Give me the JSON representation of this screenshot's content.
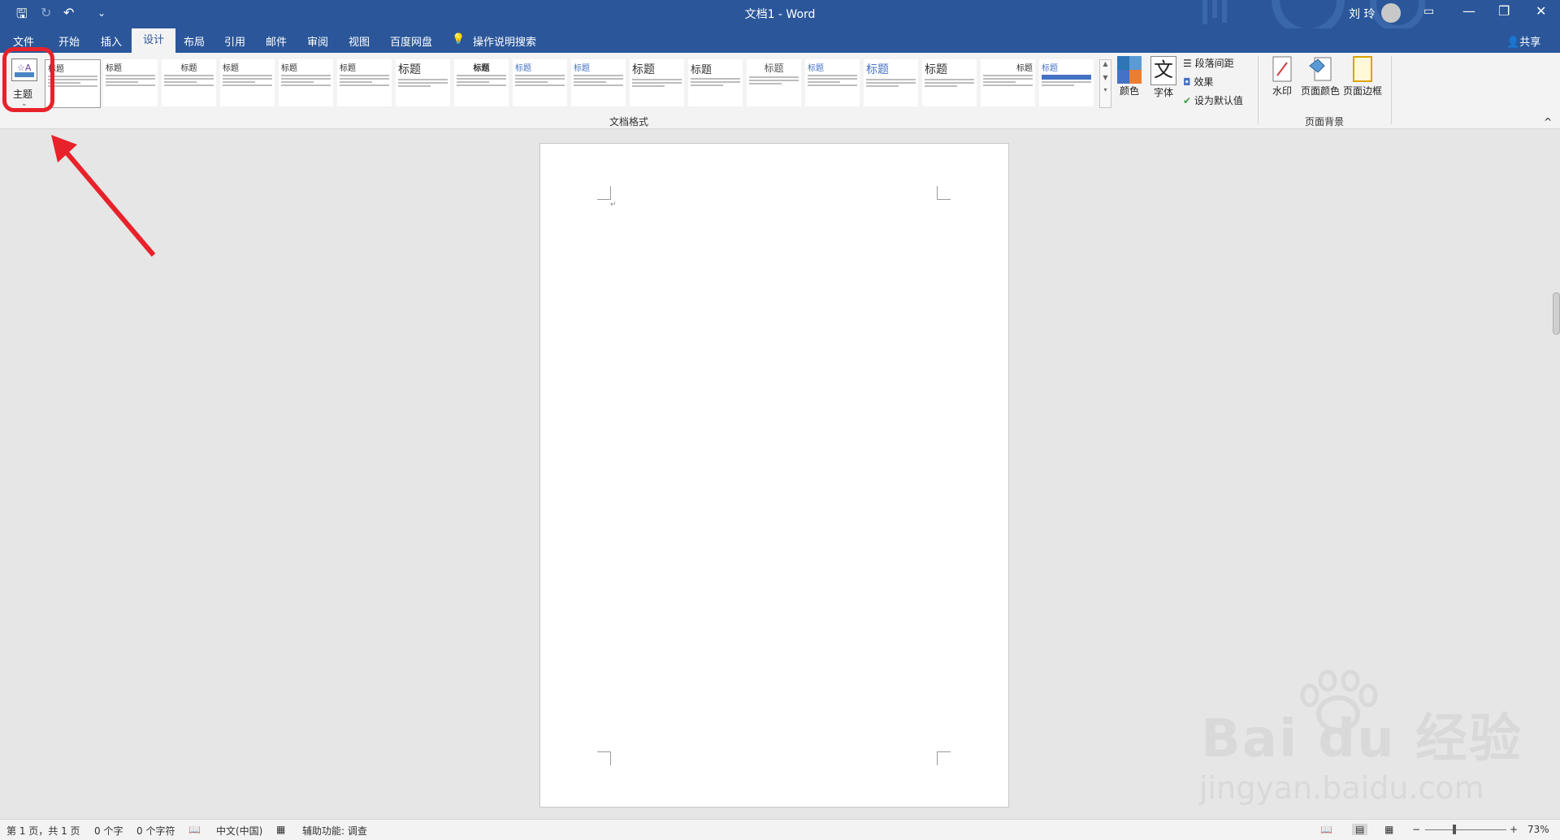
{
  "titlebar": {
    "doc_title": "文档1 - Word",
    "user_name": "刘 玲",
    "qa_save": "🖫",
    "qa_redo": "↻",
    "qa_undo": "↶",
    "qa_customize": "⌄",
    "ribbon_display": "▭",
    "minimize": "—",
    "restore": "❐",
    "close": "✕"
  },
  "tabs": [
    "文件",
    "开始",
    "插入",
    "设计",
    "布局",
    "引用",
    "邮件",
    "审阅",
    "视图",
    "百度网盘"
  ],
  "active_tab": "设计",
  "tell_me": "操作说明搜索",
  "share": "共享",
  "ribbon": {
    "theme_label": "主题",
    "styles_group_label": "文档格式",
    "style_titles": [
      "标题",
      "标题",
      "标题",
      "标题",
      "标题",
      "标题",
      "标题",
      "标题",
      "标题",
      "标题",
      "标题",
      "标题",
      "标题",
      "标题",
      "标题",
      "标题",
      "标题",
      "标题"
    ],
    "colors_label": "颜色",
    "fonts_label": "字体",
    "fonts_glyph": "文",
    "paragraph_spacing": "段落间距",
    "effects": "效果",
    "set_default": "设为默认值",
    "watermark": "水印",
    "page_color": "页面颜色",
    "page_borders": "页面边框",
    "background_group_label": "页面背景",
    "collapse": "^"
  },
  "status": {
    "page": "第 1 页，共 1 页",
    "words": "0 个字",
    "chars": "0 个字符",
    "language": "中文(中国)",
    "accessibility": "辅助功能: 调查",
    "zoom": "73%"
  },
  "colors": {
    "brand": "#2b579a",
    "highlight": "#e8222a"
  },
  "watermark": {
    "brand": "Bai  du 经验",
    "url": "jingyan.baidu.com"
  }
}
